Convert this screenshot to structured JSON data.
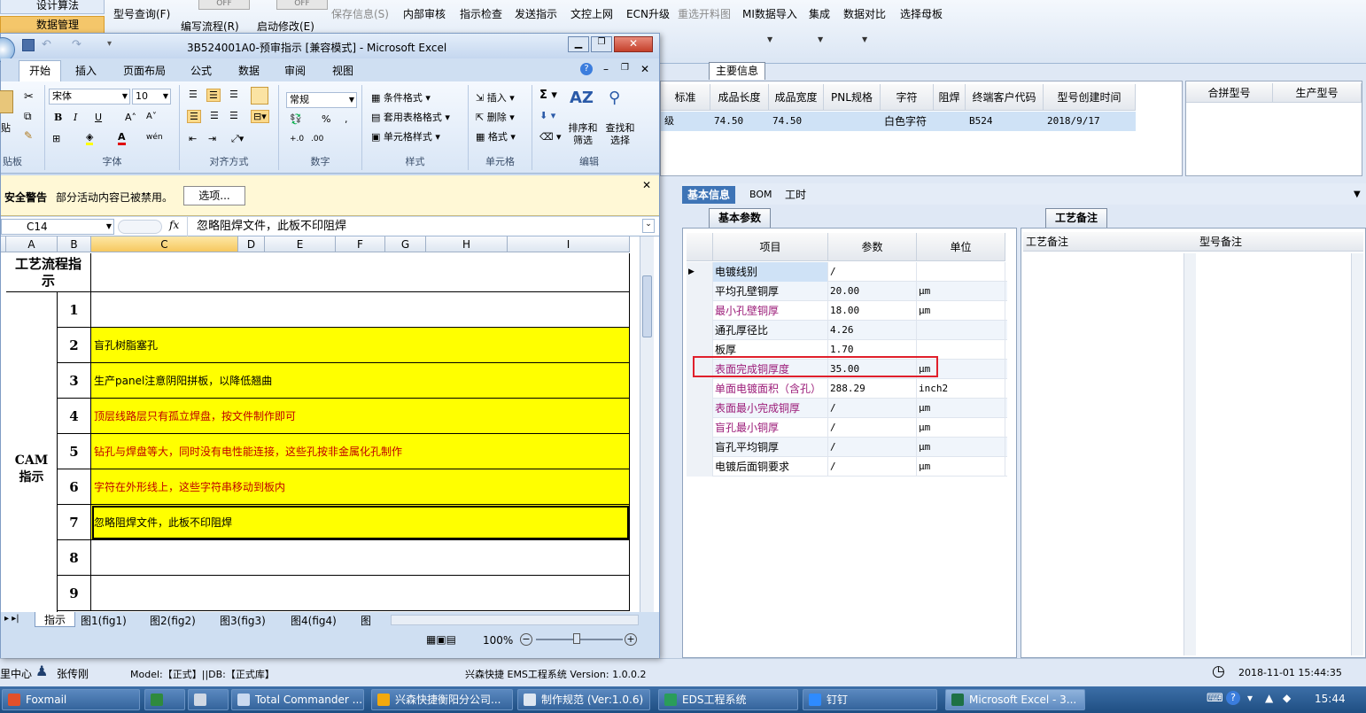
{
  "host": {
    "left_nav": [
      "设计算法",
      "数据管理"
    ],
    "toolbar": [
      {
        "label": "型号查询(F)",
        "disabled": false
      },
      {
        "label": "编写流程(R)",
        "disabled": false
      },
      {
        "label": "启动修改(E)",
        "disabled": false
      },
      {
        "label": "保存信息(S)",
        "disabled": true
      },
      {
        "label": "内部审核",
        "disabled": false
      },
      {
        "label": "指示检查",
        "disabled": false
      },
      {
        "label": "发送指示",
        "disabled": false
      },
      {
        "label": "文控上网",
        "disabled": false
      },
      {
        "label": "ECN升级",
        "disabled": false
      },
      {
        "label": "重选开料图",
        "disabled": true
      },
      {
        "label": "MI数据导入",
        "disabled": false
      },
      {
        "label": "集成",
        "disabled": false
      },
      {
        "label": "数据对比",
        "disabled": false
      },
      {
        "label": "选择母板",
        "disabled": false
      }
    ],
    "toggle_off": "OFF",
    "main_info": {
      "tab": "主要信息",
      "headers": [
        "标准",
        "成品长度",
        "成品宽度",
        "PNL规格",
        "字符",
        "阻焊",
        "终端客户代码",
        "型号创建时间"
      ],
      "row": [
        "级",
        "74.50",
        "74.50",
        "",
        "白色字符",
        "",
        "B524",
        "2018/9/17"
      ]
    },
    "merge_headers": [
      "合拼型号",
      "生产型号"
    ],
    "tabs": [
      "基本信息",
      "BOM",
      "工时"
    ],
    "basic_params": {
      "title": "基本参数",
      "headers": [
        "项目",
        "参数",
        "单位"
      ],
      "rows": [
        {
          "item": "电镀线别",
          "value": "/",
          "unit": "",
          "purple": false,
          "selected": true
        },
        {
          "item": "平均孔壁铜厚",
          "value": "20.00",
          "unit": "μm",
          "purple": false
        },
        {
          "item": "最小孔壁铜厚",
          "value": "18.00",
          "unit": "μm",
          "purple": true
        },
        {
          "item": "通孔厚径比",
          "value": "4.26",
          "unit": "",
          "purple": false
        },
        {
          "item": "板厚",
          "value": "1.70",
          "unit": "",
          "purple": false
        },
        {
          "item": "表面完成铜厚度",
          "value": "35.00",
          "unit": "μm",
          "purple": true
        },
        {
          "item": "单面电镀面积（含孔）",
          "value": "288.29",
          "unit": "inch2",
          "purple": true
        },
        {
          "item": "表面最小完成铜厚",
          "value": "/",
          "unit": "μm",
          "purple": true
        },
        {
          "item": "盲孔最小铜厚",
          "value": "/",
          "unit": "μm",
          "purple": true
        },
        {
          "item": "盲孔平均铜厚",
          "value": "/",
          "unit": "μm",
          "purple": false
        },
        {
          "item": "电镀后面铜要求",
          "value": "/",
          "unit": "μm",
          "purple": false
        }
      ]
    },
    "remarks": {
      "title": "工艺备注",
      "col1": "工艺备注",
      "col2": "型号备注"
    },
    "status": {
      "center": "里中心",
      "user": "张传刚",
      "model": "Model:【正式】||DB:【正式库】",
      "system": "兴森快捷 EMS工程系统 Version: 1.0.0.2",
      "datetime": "2018-11-01 15:44:35"
    }
  },
  "excel": {
    "title": "3B524001A0-预审指示 [兼容模式] - Microsoft Excel",
    "ribbon_tabs": [
      "开始",
      "插入",
      "页面布局",
      "公式",
      "数据",
      "审阅",
      "视图"
    ],
    "font_name": "宋体",
    "font_size": "10",
    "number_format": "常规",
    "groups": [
      "贴板",
      "字体",
      "对齐方式",
      "数字",
      "样式",
      "单元格",
      "编辑"
    ],
    "style_buttons": [
      "条件格式",
      "套用表格格式",
      "单元格样式"
    ],
    "cell_buttons": [
      "插入",
      "删除",
      "格式"
    ],
    "edit_buttons": [
      "排序和筛选",
      "查找和选择"
    ],
    "paste_label": "贴",
    "security_label": "安全警告",
    "security_text": "部分活动内容已被禁用。",
    "options_button": "选项...",
    "name_box": "C14",
    "fx": "fx",
    "formula": "忽略阻焊文件，此板不印阻焊",
    "columns": [
      "A",
      "B",
      "C",
      "D",
      "E",
      "F",
      "G",
      "H",
      "I"
    ],
    "process_title": "工艺流程指示",
    "cam_title": "CAM指示",
    "rows": [
      {
        "n": "1",
        "text": "",
        "fill": false,
        "color": "#000000"
      },
      {
        "n": "2",
        "text": "盲孔树脂塞孔",
        "fill": true,
        "color": "#000000"
      },
      {
        "n": "3",
        "text": "生产panel注意阴阳拼板，以降低翘曲",
        "fill": true,
        "color": "#000000"
      },
      {
        "n": "4",
        "text": "顶层线路层只有孤立焊盘，按文件制作即可",
        "fill": true,
        "color": "#c00000"
      },
      {
        "n": "5",
        "text": "钻孔与焊盘等大，同时没有电性能连接，这些孔按非金属化孔制作",
        "fill": true,
        "color": "#c00000"
      },
      {
        "n": "6",
        "text": "字符在外形线上，这些字符串移动到板内",
        "fill": true,
        "color": "#c00000"
      },
      {
        "n": "7",
        "text": "忽略阻焊文件，此板不印阻焊",
        "fill": true,
        "color": "#000000"
      },
      {
        "n": "8",
        "text": "",
        "fill": false,
        "color": "#000000"
      },
      {
        "n": "9",
        "text": "",
        "fill": false,
        "color": "#000000"
      }
    ],
    "sheet_tabs": [
      "指示",
      "图1(fig1)",
      "图2(fig2)",
      "图3(fig3)",
      "图4(fig4)",
      "图"
    ],
    "zoom": "100%"
  },
  "taskbar": {
    "items": [
      "Foxmail",
      "",
      "",
      "Total Commander ...",
      "兴森快捷衡阳分公司...",
      "制作规范 (Ver:1.0.6)",
      "EDS工程系统",
      "钉钉",
      "Microsoft Excel - 3..."
    ],
    "clock": "15:44"
  }
}
